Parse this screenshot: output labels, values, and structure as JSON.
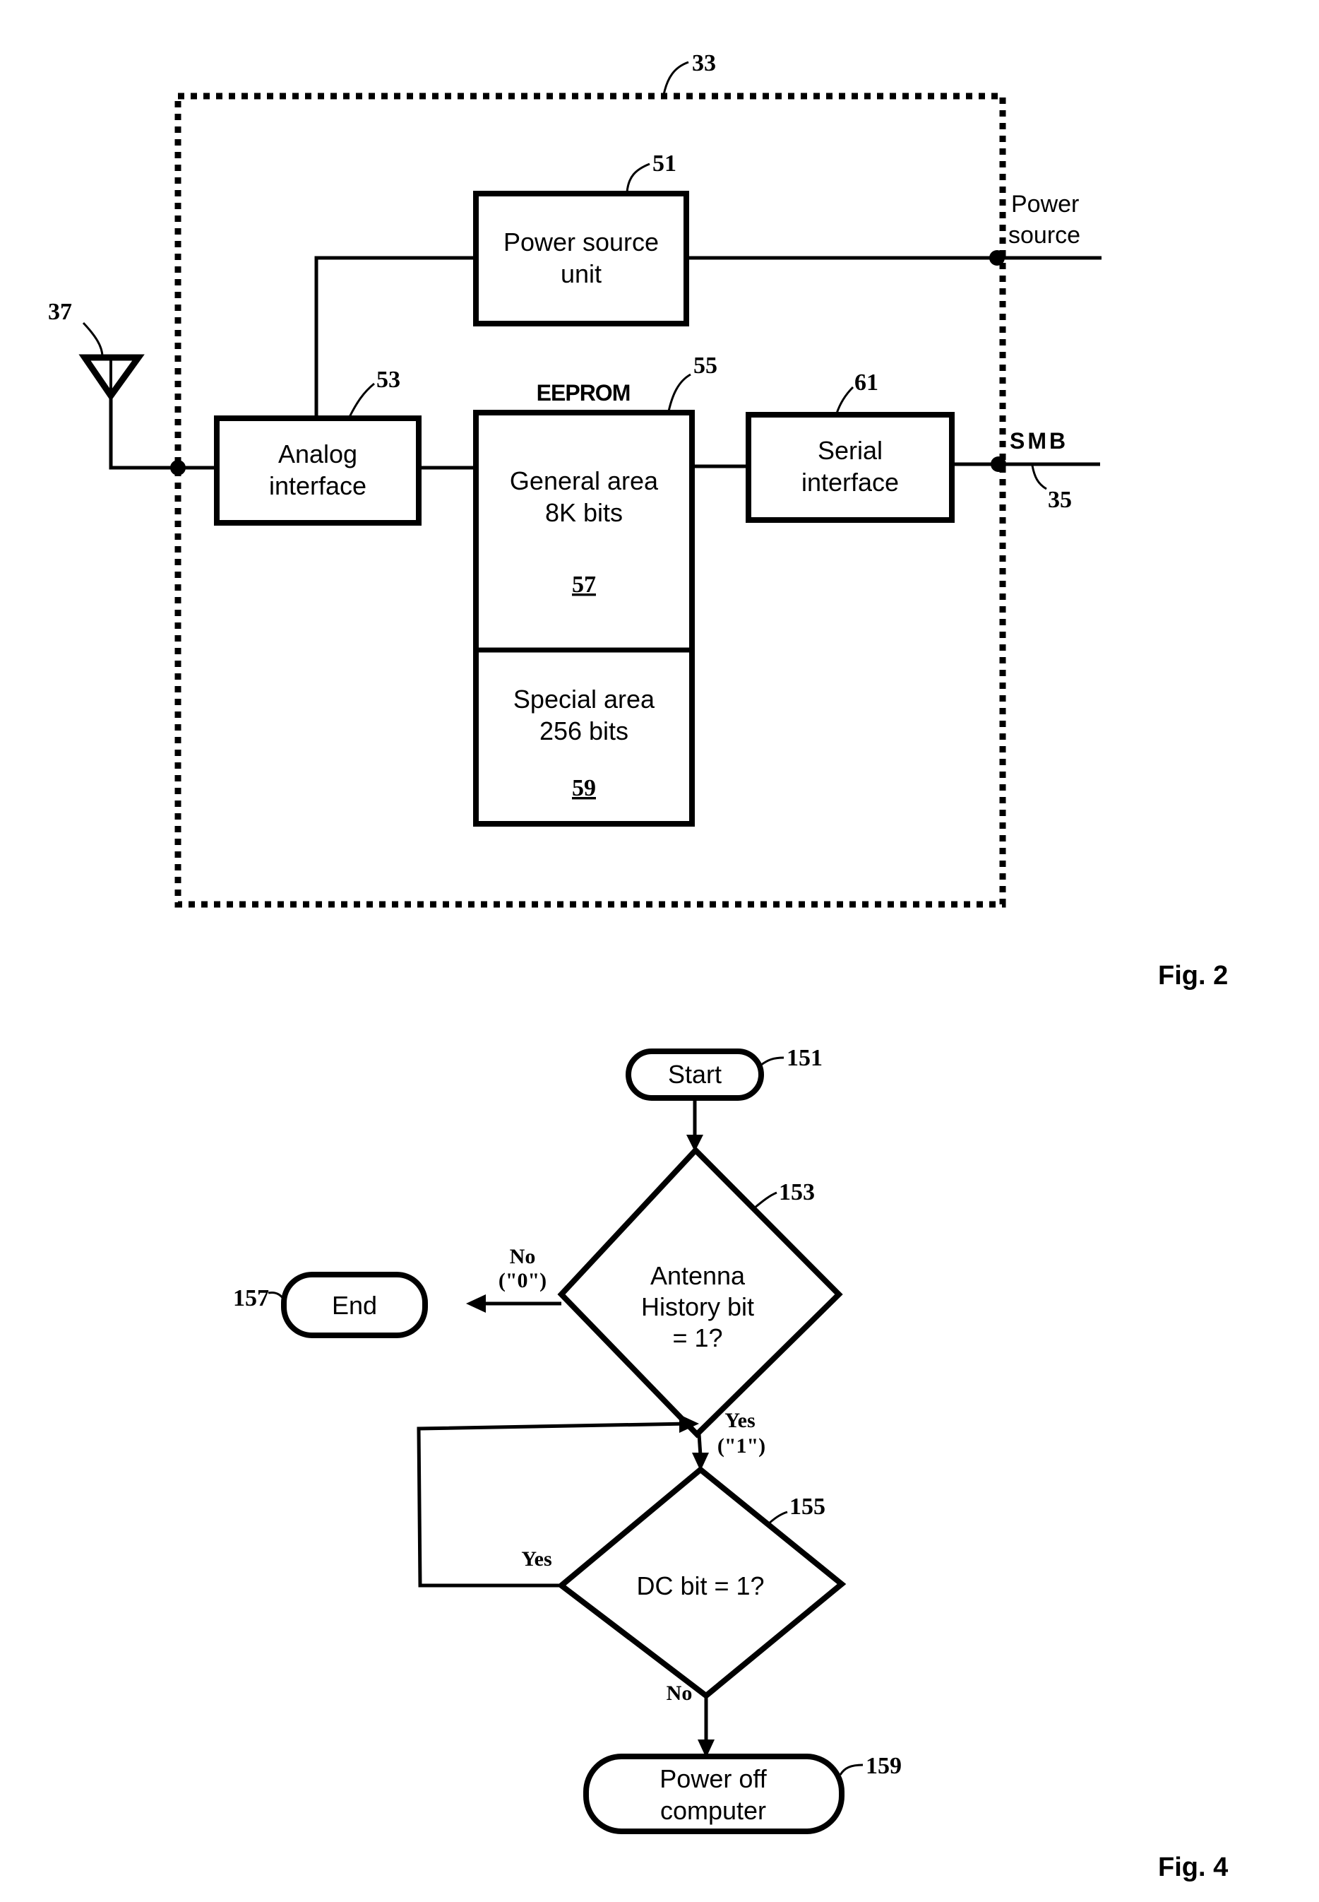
{
  "fig2": {
    "caption": "Fig. 2",
    "module_ref": "33",
    "antenna_ref": "37",
    "power_unit": {
      "ref": "51",
      "line1": "Power source",
      "line2": "unit"
    },
    "analog_interface": {
      "ref": "53",
      "line1": "Analog",
      "line2": "interface"
    },
    "eeprom": {
      "title": "EEPROM",
      "ref": "55",
      "general_area": {
        "line1": "General area",
        "line2": "8K bits",
        "ref": "57"
      },
      "special_area": {
        "line1": "Special area",
        "line2": "256 bits",
        "ref": "59"
      }
    },
    "serial_interface": {
      "ref": "61",
      "line1": "Serial",
      "line2": "interface"
    },
    "external_power": {
      "line1": "Power",
      "line2": "source"
    },
    "bus": {
      "label": "SMB",
      "ref": "35"
    }
  },
  "fig4": {
    "caption": "Fig. 4",
    "start": {
      "label": "Start",
      "ref": "151"
    },
    "decision1": {
      "line1": "Antenna",
      "line2": "History bit",
      "line3": "= 1?",
      "ref": "153"
    },
    "end": {
      "label": "End",
      "ref": "157"
    },
    "no_branch1": {
      "line1": "No",
      "line2": "(\"0\")"
    },
    "yes_branch1": {
      "line1": "Yes",
      "line2": "(\"1\")"
    },
    "decision2": {
      "label": "DC bit = 1?",
      "ref": "155"
    },
    "yes_branch2": "Yes",
    "no_branch2": "No",
    "power_off": {
      "line1": "Power off",
      "line2": "computer",
      "ref": "159"
    }
  }
}
